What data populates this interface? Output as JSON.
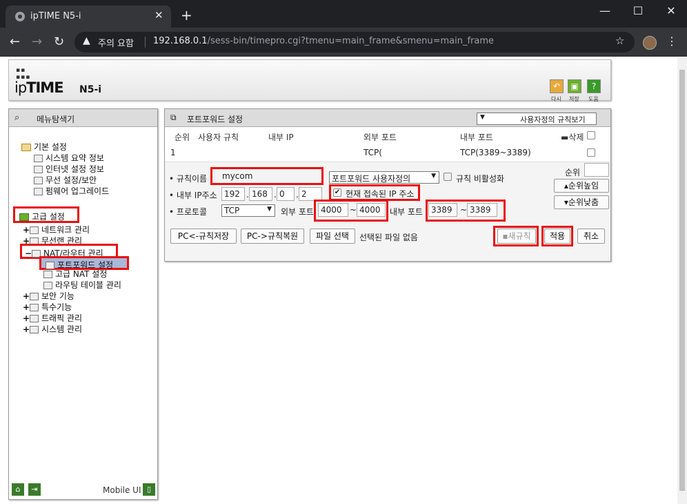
{
  "browser": {
    "tab_title": "ipTIME N5-i",
    "security_label": "주의 요함",
    "url_host": "192.168.0.1",
    "url_path": "/sess-bin/timepro.cgi?tmenu=main_frame&smenu=main_frame"
  },
  "header": {
    "logo_pre": "ip",
    "logo_bold": "TIME",
    "model": "N5-i",
    "actions": [
      {
        "label": "다시",
        "icon": "refresh-icon",
        "color": "#e8a93a"
      },
      {
        "label": "저장",
        "icon": "save-icon",
        "color": "#6ab02a"
      },
      {
        "label": "도움",
        "icon": "help-icon",
        "color": "#3a9a2a"
      }
    ]
  },
  "sidebar": {
    "title": "메뉴탐색기",
    "basic": {
      "label": "기본 설정",
      "items": [
        "시스템 요약 정보",
        "인터넷 설정 정보",
        "무선 설정/보안",
        "펌웨어 업그레이드"
      ]
    },
    "advanced": {
      "label": "고급 설정",
      "items": [
        "네트워크 관리",
        "무선랜 관리",
        "NAT/라우터 관리"
      ],
      "nat_items": [
        "포트포워드 설정",
        "고급 NAT 설정",
        "라우팅 테이블 관리"
      ],
      "more": [
        "보안 기능",
        "특수기능",
        "트래픽 관리",
        "시스템 관리"
      ]
    },
    "mobile_label": "Mobile UI"
  },
  "main": {
    "title": "포트포워드 설정",
    "view_select": "사용자정의 규칙보기",
    "columns": [
      "순위",
      "사용자 규칙",
      "내부 IP",
      "외부 포트",
      "내부 포트",
      "삭제"
    ],
    "rows": [
      {
        "rank": "1",
        "rule": "",
        "ip": "",
        "ext": "TCP(",
        "int": "TCP(3389~3389)"
      }
    ],
    "form": {
      "rule_name_label": "규칙이름",
      "rule_name_value": "mycom",
      "preset_select": "포트포워드 사용자정의",
      "disable_label": "규칙 비활성화",
      "ip_label": "내부 IP주소",
      "ip": [
        "192",
        "168",
        "0",
        "2"
      ],
      "current_ip_label": "현재 접속된 IP 주소",
      "protocol_label": "프로토콜",
      "protocol": "TCP",
      "ext_port_label": "외부 포트",
      "ext_from": "4000",
      "ext_to": "4000",
      "int_port_label": "내부 포트",
      "int_from": "3389",
      "int_to": "3389",
      "rank_label": "순위",
      "rank_up": "순위높임",
      "rank_down": "순위낮춤",
      "save_pc": "PC<-규칙저장",
      "restore_pc": "PC->규칙복원",
      "file_select": "파일 선택",
      "file_none": "선택된 파일 없음",
      "new_rule": "새규칙",
      "apply": "적용",
      "cancel": "취소"
    }
  }
}
